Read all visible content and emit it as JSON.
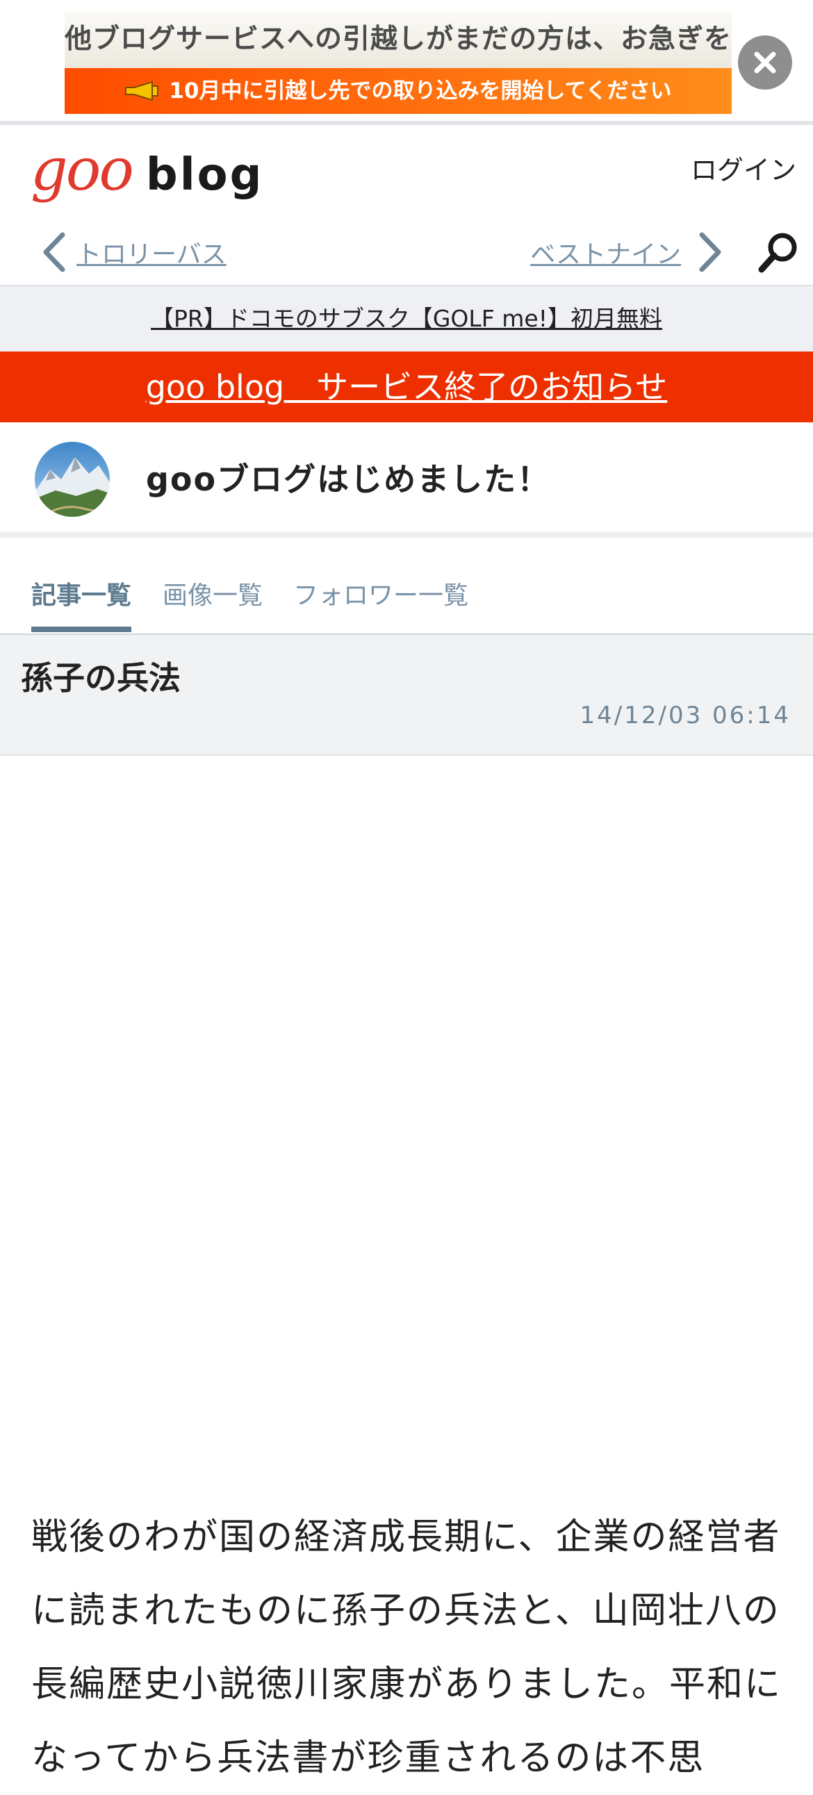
{
  "ad_banner": {
    "line1": "他ブログサービスへの引越しがまだの方は、お急ぎを！",
    "line2": "10月中に引越し先での取り込みを開始してください",
    "close_icon": "close-x-icon"
  },
  "header": {
    "logo_goo": "goo",
    "logo_blog": "blog",
    "login_label": "ログイン"
  },
  "nav": {
    "prev_label": "トロリーバス",
    "next_label": "ベストナイン",
    "search_icon": "search-icon"
  },
  "pr": {
    "text": "【PR】ドコモのサブスク【GOLF me!】初月無料"
  },
  "notice": {
    "text": "goo blog　サービス終了のお知らせ"
  },
  "blog": {
    "title": "gooブログはじめました！"
  },
  "tabs": [
    {
      "label": "記事一覧",
      "active": true
    },
    {
      "label": "画像一覧",
      "active": false
    },
    {
      "label": "フォロワー一覧",
      "active": false
    }
  ],
  "article": {
    "title": "孫子の兵法",
    "date": "14/12/03 06:14",
    "body": "戦後のわが国の経済成長期に、企業の経営者に読まれたものに孫子の兵法と、山岡壮八の長編歴史小説徳川家康がありました。平和になってから兵法書が珍重されるのは不思"
  },
  "colors": {
    "accent_red": "#e0392e",
    "notice_red": "#ee3000",
    "link_blue_gray": "#7a93a8",
    "banner_orange": "#ff6a00"
  }
}
